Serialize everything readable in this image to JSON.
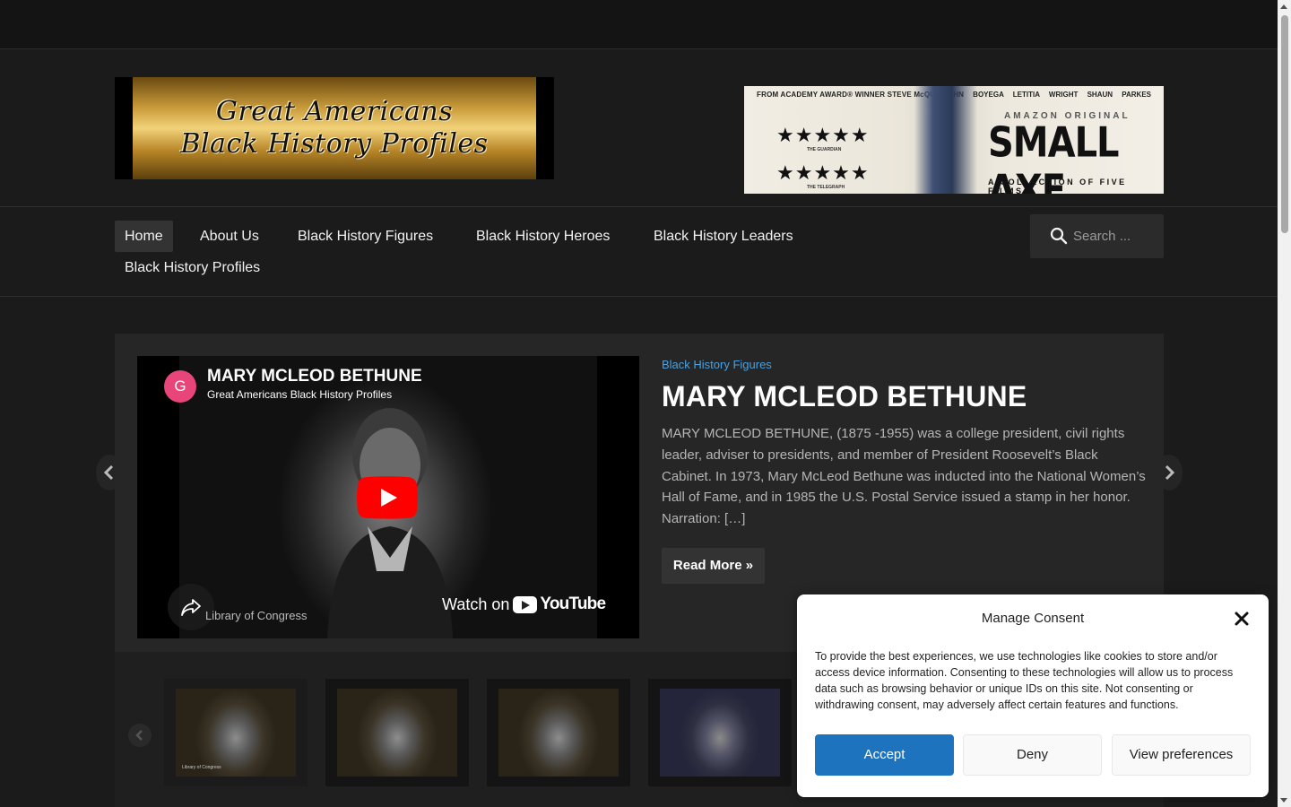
{
  "logo": {
    "line1": "Great Americans",
    "line2": "Black History Profiles"
  },
  "ad": {
    "tagline": "FROM ACADEMY AWARD® WINNER STEVE McQUEEN",
    "cast": "JOHN BOYEGA LETITIA WRIGHT SHAUN PARKES",
    "stars1": "★★★★★",
    "source1": "THE GUARDIAN",
    "stars2": "★★★★★",
    "source2": "THE TELEGRAPH",
    "label": "AMAZON ORIGINAL",
    "title": "SMALL AXE",
    "subtitle": "A COLLECTION OF FIVE FILMS"
  },
  "nav": {
    "items": [
      {
        "label": "Home",
        "active": true
      },
      {
        "label": "About Us"
      },
      {
        "label": "Black History Figures"
      },
      {
        "label": "Black History Heroes"
      },
      {
        "label": "Black History Leaders"
      },
      {
        "label": "Black History Profiles"
      }
    ],
    "search_placeholder": "Search ..."
  },
  "featured": {
    "video": {
      "avatar_letter": "G",
      "title": "MARY MCLEOD BETHUNE",
      "channel": "Great Americans Black History Profiles",
      "credit": "Library of Congress",
      "watch_label": "Watch on",
      "youtube_label": "YouTube"
    },
    "category": "Black History Figures",
    "title": "MARY MCLEOD BETHUNE",
    "excerpt": "MARY MCLEOD BETHUNE, (1875 -1955) was a college president, civil rights leader, adviser to presidents, and member of President Roosevelt’s Black Cabinet. In 1973, Mary McLeod Bethune was inducted into the National Women’s Hall of Fame, and in 1985 the U.S. Postal Service issued a stamp in her honor. Narration: […]",
    "read_more": "Read More »"
  },
  "thumbnails": [
    {
      "label": "Library of Congress",
      "selected": true
    },
    {
      "label": ""
    },
    {
      "label": ""
    },
    {
      "label": ""
    }
  ],
  "consent": {
    "title": "Manage Consent",
    "text": "To provide the best experiences, we use technologies like cookies to store and/or access device information. Consenting to these technologies will allow us to process data such as browsing behavior or unique IDs on this site. Not consenting or withdrawing consent, may adversely affect certain features and functions.",
    "accept": "Accept",
    "deny": "Deny",
    "preferences": "View preferences"
  },
  "colors": {
    "accent": "#1e73be",
    "category_link": "#4aa0e0",
    "youtube_red": "#ff0000",
    "avatar": "#e8457a"
  }
}
